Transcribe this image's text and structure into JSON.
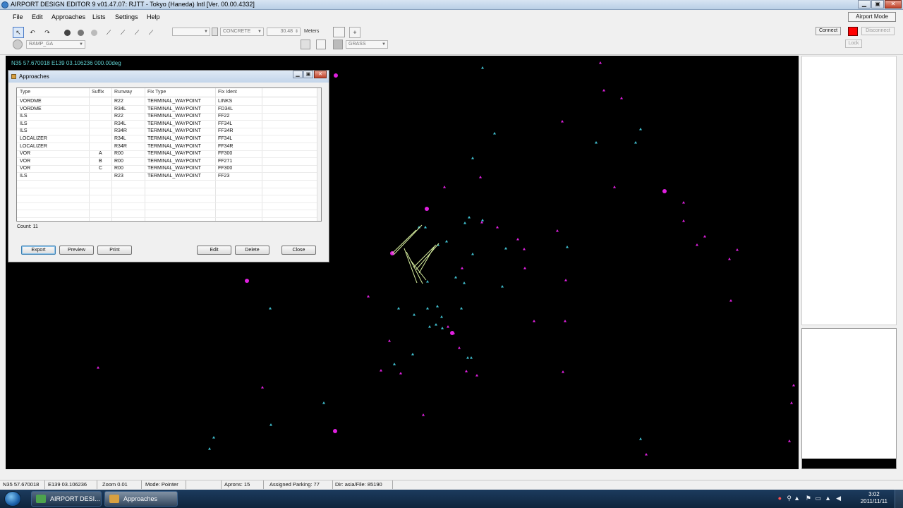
{
  "window": {
    "title": "AIRPORT DESIGN EDITOR 9  v01.47.07: RJTT - Tokyo (Haneda) Intl [Ver. 00.00.4332]",
    "minimize": "▁",
    "maximize": "▣",
    "close": "✕"
  },
  "menu": {
    "items": [
      "File",
      "Edit",
      "Approaches",
      "Lists",
      "Settings",
      "Help"
    ],
    "airport_mode": "Airport Mode"
  },
  "toolbar": {
    "undo": "↶",
    "redo": "↷",
    "ramp_select": "RAMP_GA",
    "surface_select": "CONCRETE",
    "width_value": "30.48",
    "width_unit": "Meters",
    "add": "+",
    "grass_select": "GRASS",
    "connect": "Connect",
    "disconnect": "Disconnect",
    "lock": "Lock",
    "accent_color": "#ff0000"
  },
  "map": {
    "coord_readout": "N35 57.670018   E139 03.106236 000.00deg",
    "background": "#000000",
    "waypoint_color": "#e020e0",
    "fix_color": "#40c0d0",
    "approach_color": "#d8f0a0"
  },
  "dialog": {
    "title": "Approaches",
    "columns": [
      "Type",
      "Suffix",
      "Runway",
      "Fix Type",
      "Fix Ident"
    ],
    "rows": [
      [
        "VORDME",
        "",
        "R22",
        "TERMINAL_WAYPOINT",
        "LINKS"
      ],
      [
        "VORDME",
        "",
        "R34L",
        "TERMINAL_WAYPOINT",
        "FD34L"
      ],
      [
        "ILS",
        "",
        "R22",
        "TERMINAL_WAYPOINT",
        "FF22"
      ],
      [
        "ILS",
        "",
        "R34L",
        "TERMINAL_WAYPOINT",
        "FF34L"
      ],
      [
        "ILS",
        "",
        "R34R",
        "TERMINAL_WAYPOINT",
        "FF34R"
      ],
      [
        "LOCALIZER",
        "",
        "R34L",
        "TERMINAL_WAYPOINT",
        "FF34L"
      ],
      [
        "LOCALIZER",
        "",
        "R34R",
        "TERMINAL_WAYPOINT",
        "FF34R"
      ],
      [
        "VOR",
        "A",
        "R00",
        "TERMINAL_WAYPOINT",
        "FF300"
      ],
      [
        "VOR",
        "B",
        "R00",
        "TERMINAL_WAYPOINT",
        "FF271"
      ],
      [
        "VOR",
        "C",
        "R00",
        "TERMINAL_WAYPOINT",
        "FF300"
      ],
      [
        "ILS",
        "",
        "R23",
        "TERMINAL_WAYPOINT",
        "FF23"
      ]
    ],
    "count": "Count: 11",
    "buttons": {
      "export": "Export",
      "preview": "Preview",
      "print": "Print",
      "edit": "Edit",
      "delete": "Delete",
      "close": "Close"
    }
  },
  "statusbar": {
    "lat": "N35 57.670018",
    "lon": "E139 03.106236",
    "zoom": "Zoom 0.01",
    "mode": "Mode: Pointer",
    "blank": "",
    "aprons": "Aprons: 15",
    "parking": "Assigned Parking: 77",
    "dir": "Dir: asia/File: 85190"
  },
  "taskbar": {
    "tasks": [
      "AIRPORT DESI...",
      "Approaches"
    ],
    "time": "3:02",
    "date": "2011/11/11"
  }
}
